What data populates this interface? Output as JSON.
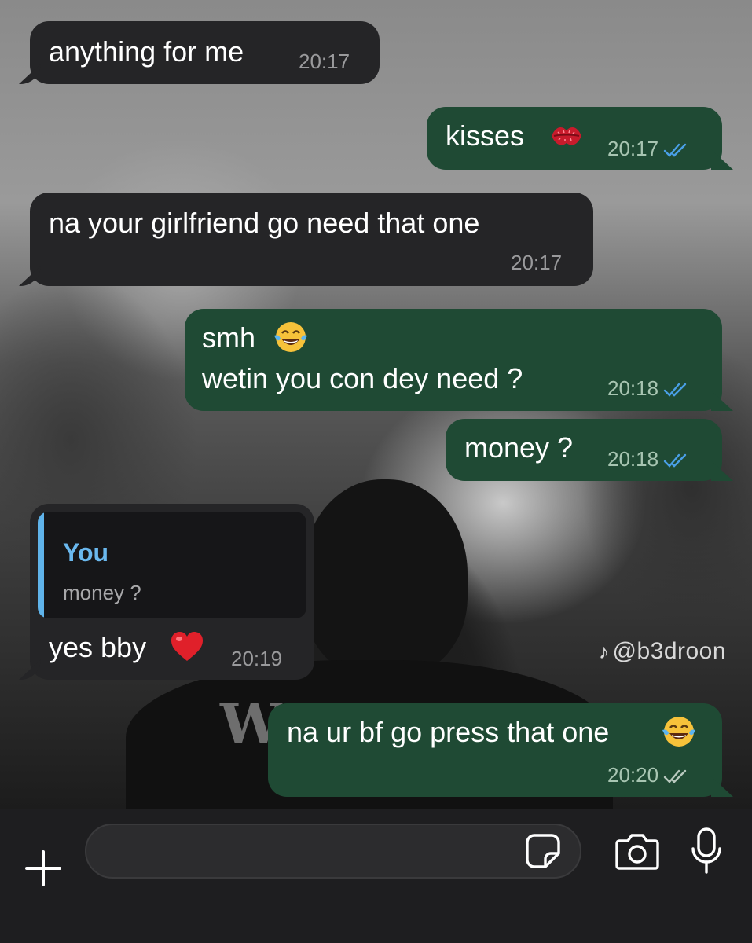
{
  "theme": {
    "incoming_bubble": "#252527",
    "outgoing_bubble": "#1f4a34",
    "read_tick_color": "#4a9fe6",
    "delivered_tick_color": "#b8c8be",
    "quote_accent": "#6ab8ee"
  },
  "wallpaper": {
    "shirt_text": "W",
    "watermark": "@b3droon",
    "watermark_icon": "tiktok-icon"
  },
  "messages": [
    {
      "direction": "incoming",
      "text": "anything for me",
      "time": "20:17"
    },
    {
      "direction": "outgoing",
      "text": "kisses",
      "emoji": "kiss-mark",
      "time": "20:17",
      "status": "read"
    },
    {
      "direction": "incoming",
      "text": "na your girlfriend go need that one",
      "time": "20:17"
    },
    {
      "direction": "outgoing",
      "line1": "smh",
      "line1_emoji": "tears-of-joy",
      "line2": "wetin you con dey need ?",
      "time": "20:18",
      "status": "read"
    },
    {
      "direction": "outgoing",
      "text": "money ?",
      "time": "20:18",
      "status": "read"
    },
    {
      "direction": "incoming",
      "reply_to": {
        "sender": "You",
        "text": "money ?"
      },
      "text": "yes bby",
      "emoji": "red-heart",
      "time": "20:19"
    },
    {
      "direction": "outgoing",
      "text": "na ur bf go press that one",
      "emoji": "tears-of-joy",
      "time": "20:20",
      "status": "delivered"
    }
  ],
  "composer": {
    "attach_icon": "plus-icon",
    "placeholder": "",
    "sticker_icon": "sticker-icon",
    "camera_icon": "camera-icon",
    "mic_icon": "microphone-icon"
  }
}
